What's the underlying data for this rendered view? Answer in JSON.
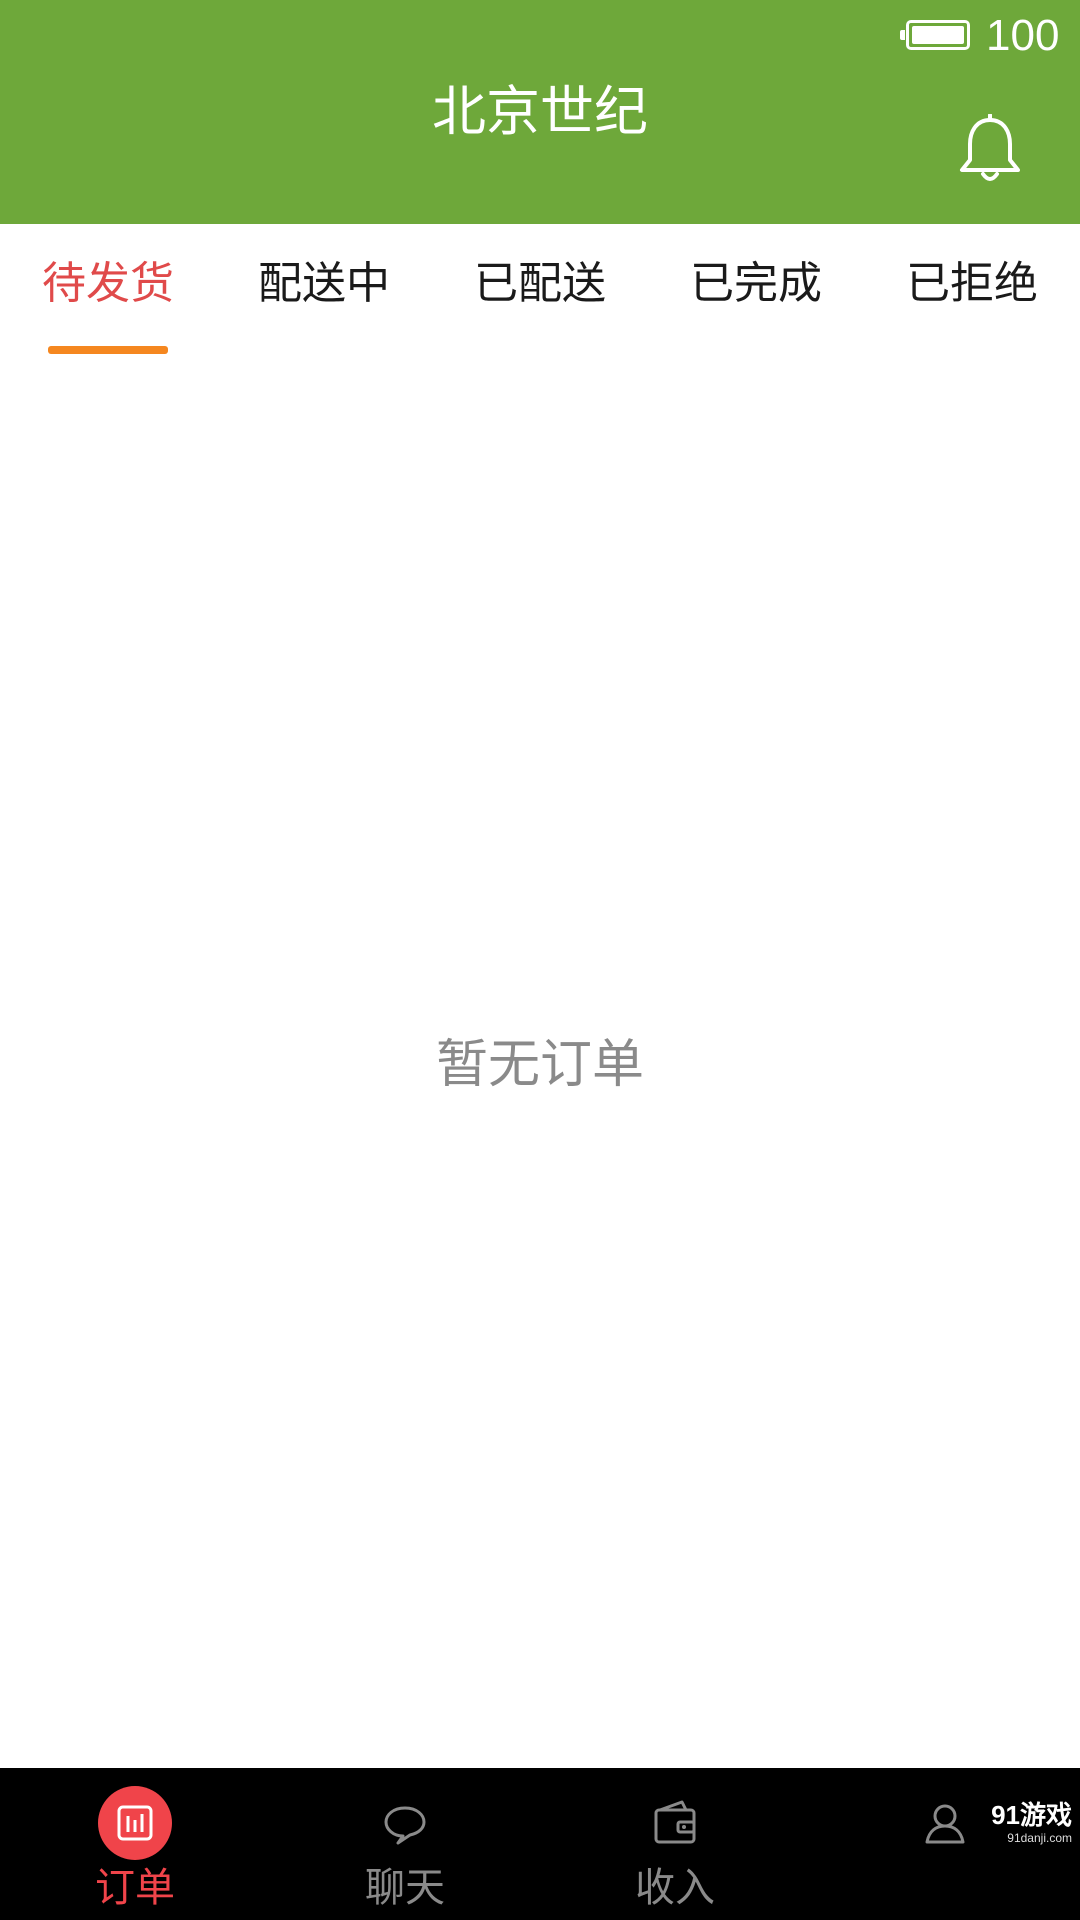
{
  "colors": {
    "header_bg": "#6ea83a",
    "active_tab": "#e04a4a",
    "tab_indicator": "#f5871f",
    "bottom_nav_bg": "#000000",
    "active_nav": "#f0444a",
    "inactive_nav": "#8a8a8a"
  },
  "status_bar": {
    "battery_level": "100",
    "battery_icon": "battery-icon"
  },
  "header": {
    "title": "北京世纪",
    "bell_icon": "bell-icon"
  },
  "tabs": [
    {
      "label": "待发货",
      "active": true
    },
    {
      "label": "配送中",
      "active": false
    },
    {
      "label": "已配送",
      "active": false
    },
    {
      "label": "已完成",
      "active": false
    },
    {
      "label": "已拒绝",
      "active": false
    }
  ],
  "main": {
    "empty_message": "暂无订单"
  },
  "bottom_nav": [
    {
      "label": "订单",
      "icon": "order-chart-icon",
      "active": true
    },
    {
      "label": "聊天",
      "icon": "chat-bubble-icon",
      "active": false
    },
    {
      "label": "收入",
      "icon": "wallet-icon",
      "active": false
    },
    {
      "label": "",
      "icon": "user-icon",
      "active": false
    }
  ],
  "watermark": {
    "main": "91游戏",
    "sub": "91danji.com"
  }
}
